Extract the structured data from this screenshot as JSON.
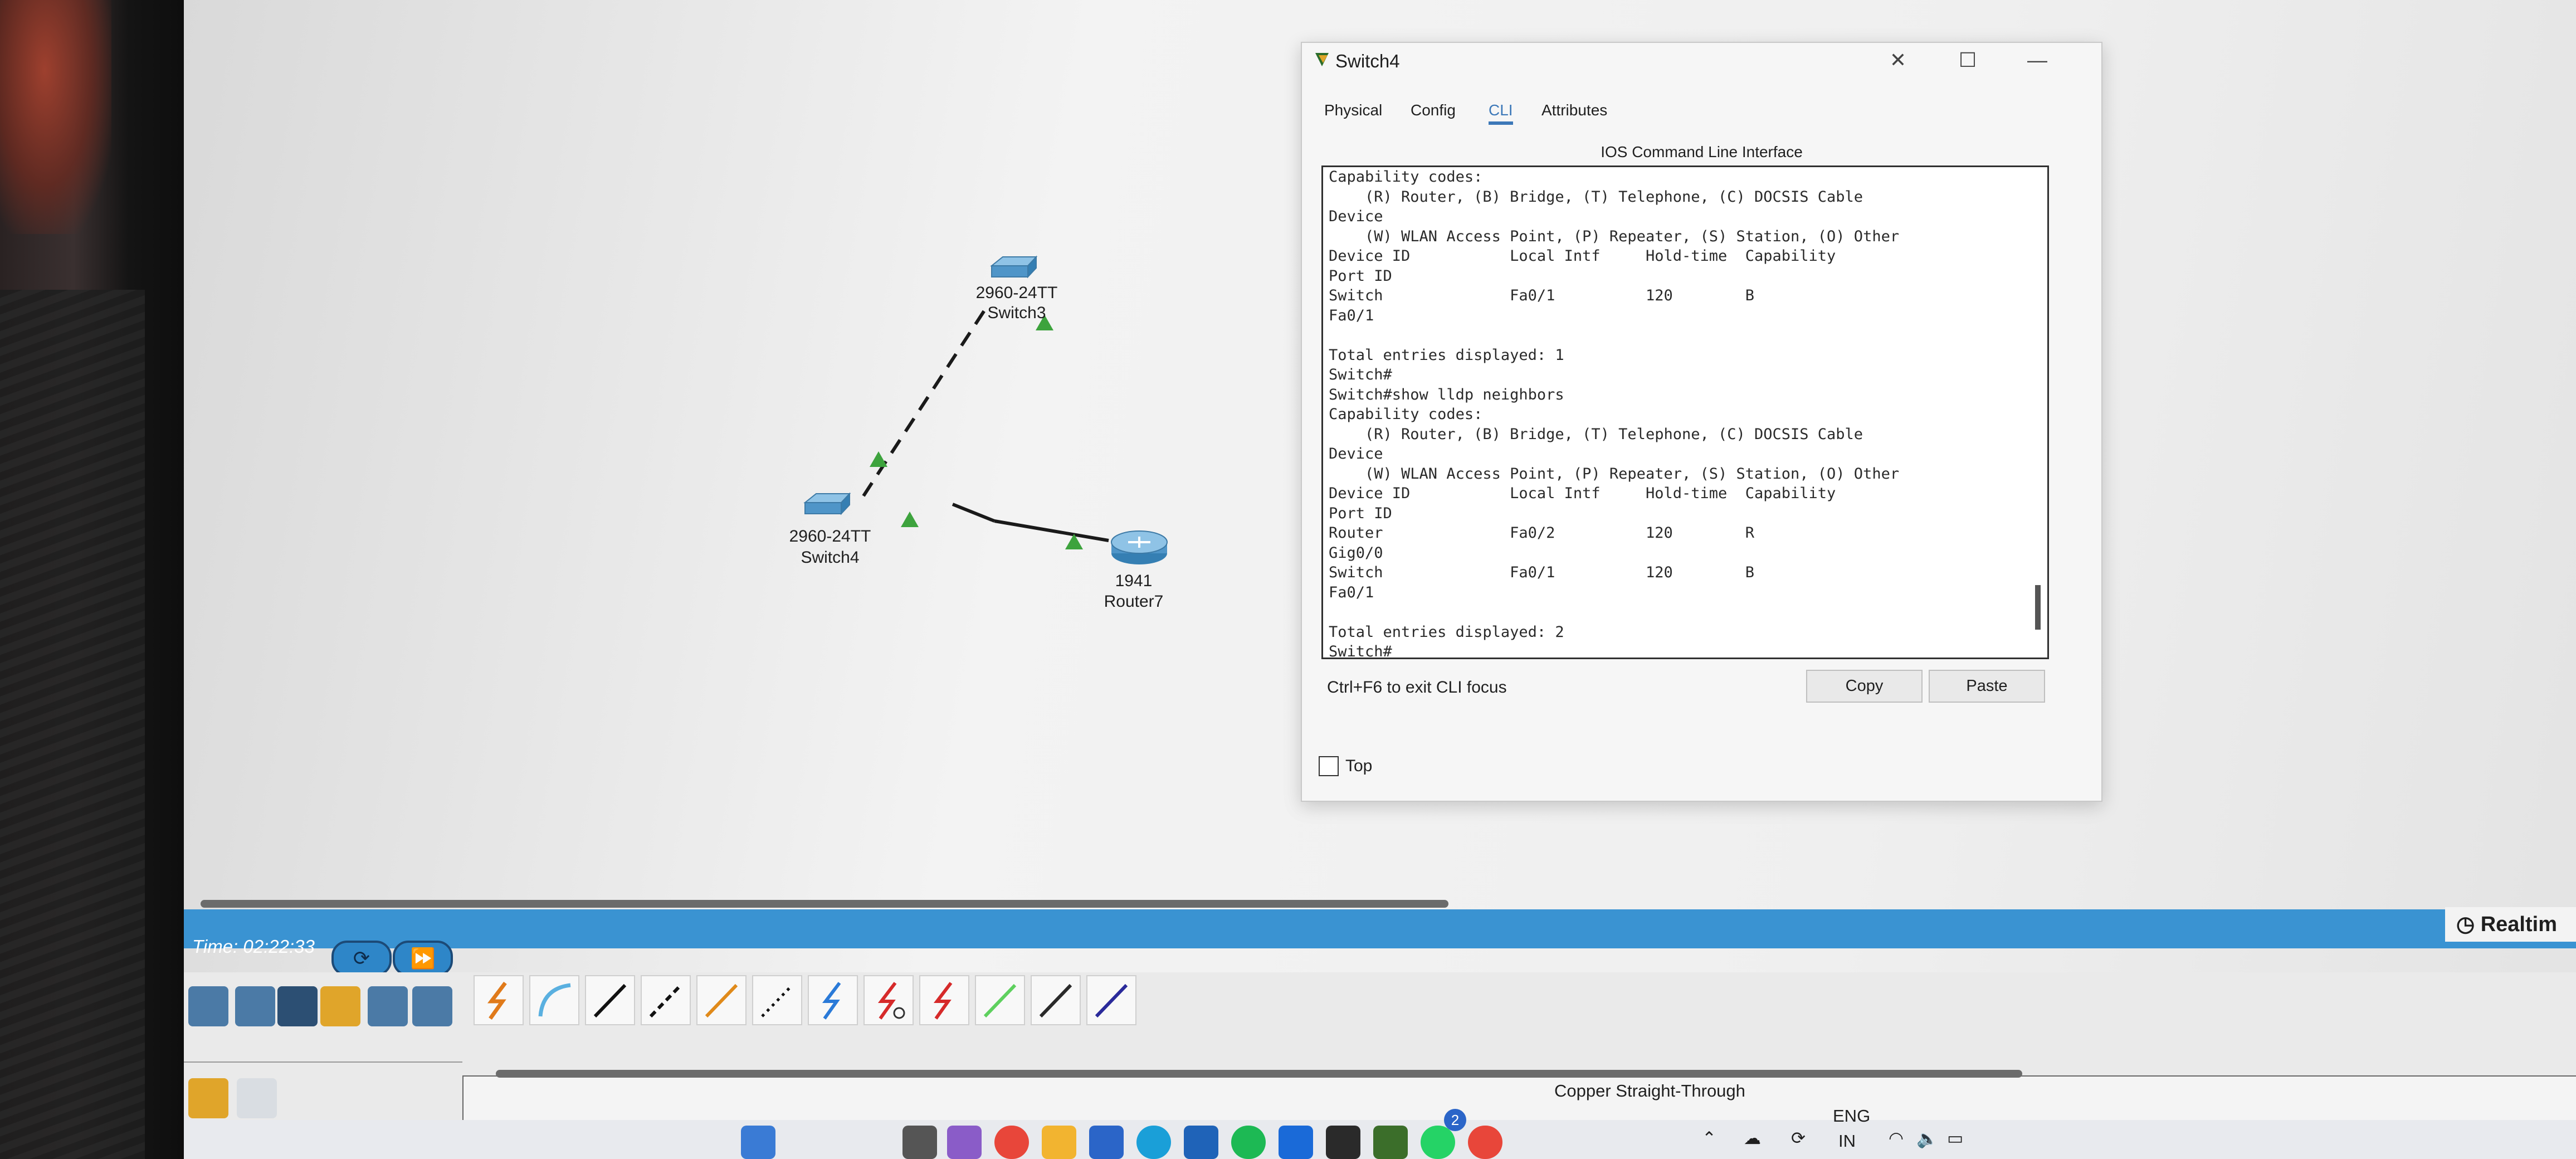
{
  "workspace": {
    "devices": [
      {
        "model": "2960-24TT",
        "name": "Switch3"
      },
      {
        "model": "2960-24TT",
        "name": "Switch4"
      },
      {
        "model": "1941",
        "name": "Router7"
      }
    ]
  },
  "cli_window": {
    "title": "Switch4",
    "controls": [
      "—",
      "☐",
      "✕"
    ],
    "tabs": [
      "Physical",
      "Config",
      "CLI",
      "Attributes"
    ],
    "active_tab": "CLI",
    "heading": "IOS Command Line Interface",
    "lines": [
      "Capability codes:",
      "    (R) Router, (B) Bridge, (T) Telephone, (C) DOCSIS Cable",
      "Device",
      "    (W) WLAN Access Point, (P) Repeater, (S) Station, (O) Other",
      "Device ID           Local Intf     Hold-time  Capability",
      "Port ID",
      "Switch              Fa0/1          120        B",
      "Fa0/1",
      "",
      "Total entries displayed: 1",
      "Switch#",
      "Switch#show lldp neighbors",
      "Capability codes:",
      "    (R) Router, (B) Bridge, (T) Telephone, (C) DOCSIS Cable",
      "Device",
      "    (W) WLAN Access Point, (P) Repeater, (S) Station, (O) Other",
      "Device ID           Local Intf     Hold-time  Capability",
      "Port ID",
      "Router              Fa0/2          120        R",
      "Gig0/0",
      "Switch              Fa0/1          120        B",
      "Fa0/1",
      "",
      "Total entries displayed: 2",
      "Switch#"
    ],
    "hint": "Ctrl+F6 to exit CLI focus",
    "copy_label": "Copy",
    "paste_label": "Paste",
    "top_label": "Top"
  },
  "sim_bar": {
    "time_label": "Time: 02:22:33",
    "mode_label": "Realtim"
  },
  "status_bar": {
    "text": "Copper Straight-Through"
  },
  "taskbar": {
    "lang": "ENG",
    "region": "IN",
    "whatsapp_badge": "2"
  },
  "colors": {
    "accent": "#3c78b8",
    "time_bar": "#3a93d2",
    "link_up": "#3da33d"
  }
}
